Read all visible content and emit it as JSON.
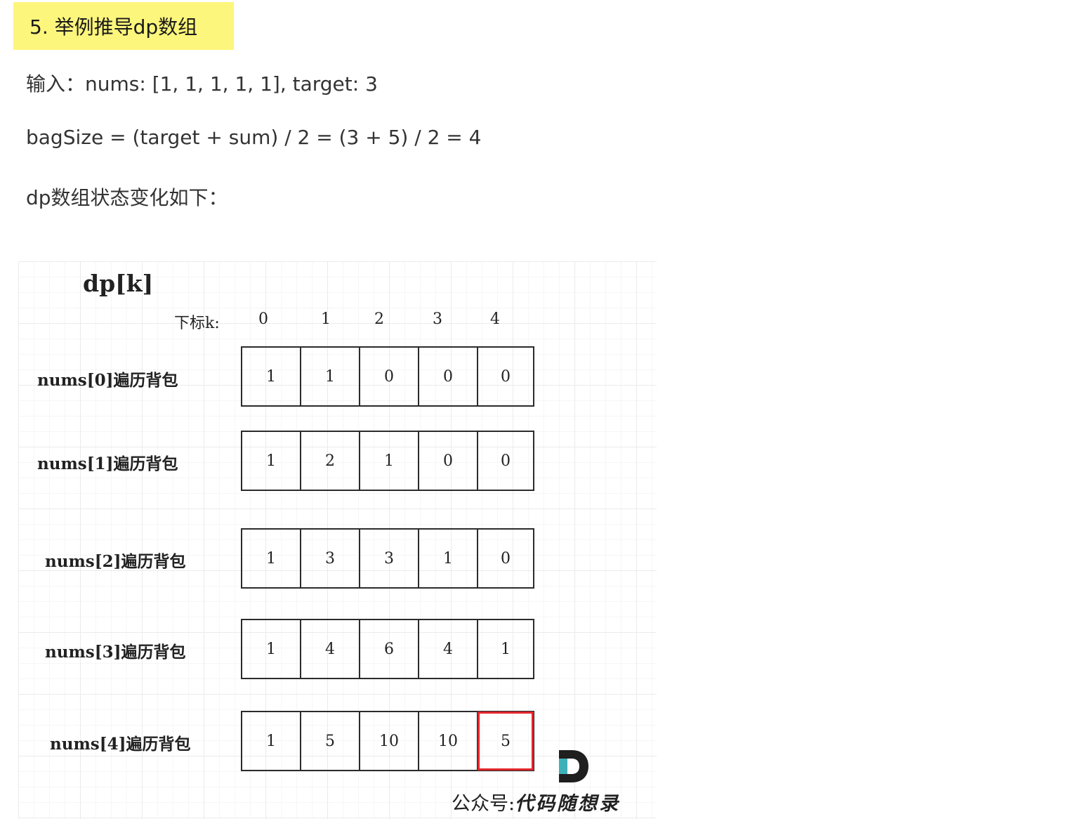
{
  "heading": "5. 举例推导dp数组",
  "paragraphs": [
    "输入：nums: [1, 1, 1, 1, 1], target: 3",
    "bagSize = (target + sum) / 2 = (3 + 5) / 2 = 4",
    "dp数组状态变化如下："
  ],
  "figure": {
    "title": "dp[k]",
    "index_label": "下标k:",
    "indices": [
      "0",
      "1",
      "2",
      "3",
      "4"
    ],
    "rows": [
      {
        "label": "nums[0]遍历背包",
        "values": [
          "1",
          "1",
          "0",
          "0",
          "0"
        ]
      },
      {
        "label": "nums[1]遍历背包",
        "values": [
          "1",
          "2",
          "1",
          "0",
          "0"
        ]
      },
      {
        "label": "nums[2]遍历背包",
        "values": [
          "1",
          "3",
          "3",
          "1",
          "0"
        ]
      },
      {
        "label": "nums[3]遍历背包",
        "values": [
          "1",
          "4",
          "6",
          "4",
          "1"
        ]
      },
      {
        "label": "nums[4]遍历背包",
        "values": [
          "1",
          "5",
          "10",
          "10",
          "5"
        ]
      }
    ],
    "highlight": {
      "row": 4,
      "col": 4,
      "color": "#e0262b"
    },
    "watermark_prefix": "公众号:",
    "watermark_brand": "代码随想录",
    "logo_letter": "D",
    "colors": {
      "heading_bg": "#fdf67c",
      "logo_teal": "#3fb0b8",
      "logo_dark": "#1f1f1f"
    }
  }
}
